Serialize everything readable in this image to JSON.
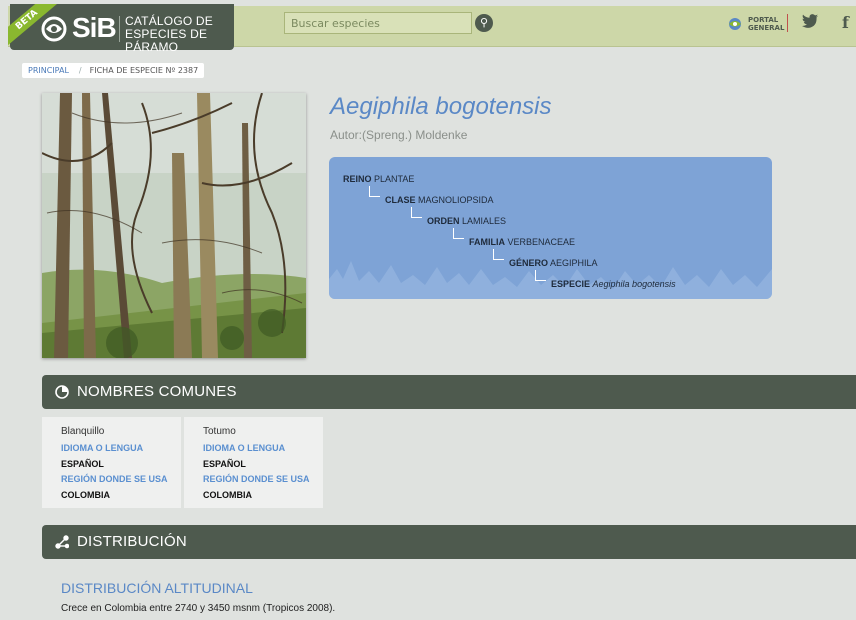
{
  "header": {
    "beta": "BETA",
    "logo_text": "SiB",
    "logo_sub_line1": "CATÁLOGO DE",
    "logo_sub_line2": "ESPECIES DE PÁRAMO",
    "search_placeholder": "Buscar especies",
    "portal_line1": "PORTAL",
    "portal_line2": "GENERAL",
    "icons": [
      "search-icon",
      "portal-icon",
      "twitter-icon",
      "facebook-icon"
    ]
  },
  "breadcrumb": {
    "home": "PRINCIPAL",
    "separator": "/",
    "current": "FICHA DE ESPECIE Nº 2387"
  },
  "species": {
    "name": "Aegiphila bogotensis",
    "author": "Autor:(Spreng.) Moldenke"
  },
  "taxonomy": [
    {
      "rank": "REINO",
      "value": "PLANTAE"
    },
    {
      "rank": "CLASE",
      "value": "MAGNOLIOPSIDA"
    },
    {
      "rank": "ORDEN",
      "value": "LAMIALES"
    },
    {
      "rank": "FAMILIA",
      "value": "VERBENACEAE"
    },
    {
      "rank": "GÉNERO",
      "value": "AEGIPHILA"
    },
    {
      "rank": "ESPECIE",
      "value": "Aegiphila bogotensis"
    }
  ],
  "common_names": {
    "title": "NOMBRES COMUNES",
    "items": [
      {
        "name": "Blanquillo",
        "label_language": "IDIOMA O LENGUA",
        "language": "ESPAÑOL",
        "label_region": "REGIÓN DONDE SE USA",
        "region": "COLOMBIA"
      },
      {
        "name": "Totumo",
        "label_language": "IDIOMA O LENGUA",
        "language": "ESPAÑOL",
        "label_region": "REGIÓN DONDE SE USA",
        "region": "COLOMBIA"
      }
    ]
  },
  "distribution": {
    "title": "DISTRIBUCIÓN",
    "subtitle": "DISTRIBUCIÓN ALTITUDINAL",
    "text": "Crece en Colombia entre 2740 y 3450 msnm (Tropicos 2008)."
  },
  "colors": {
    "header_bg": "#cdd7a8",
    "dark_green": "#4e5a4e",
    "accent_blue": "#5a88c6",
    "taxonomy_bg": "#7ea3d6",
    "beta_green": "#8ab82f"
  }
}
